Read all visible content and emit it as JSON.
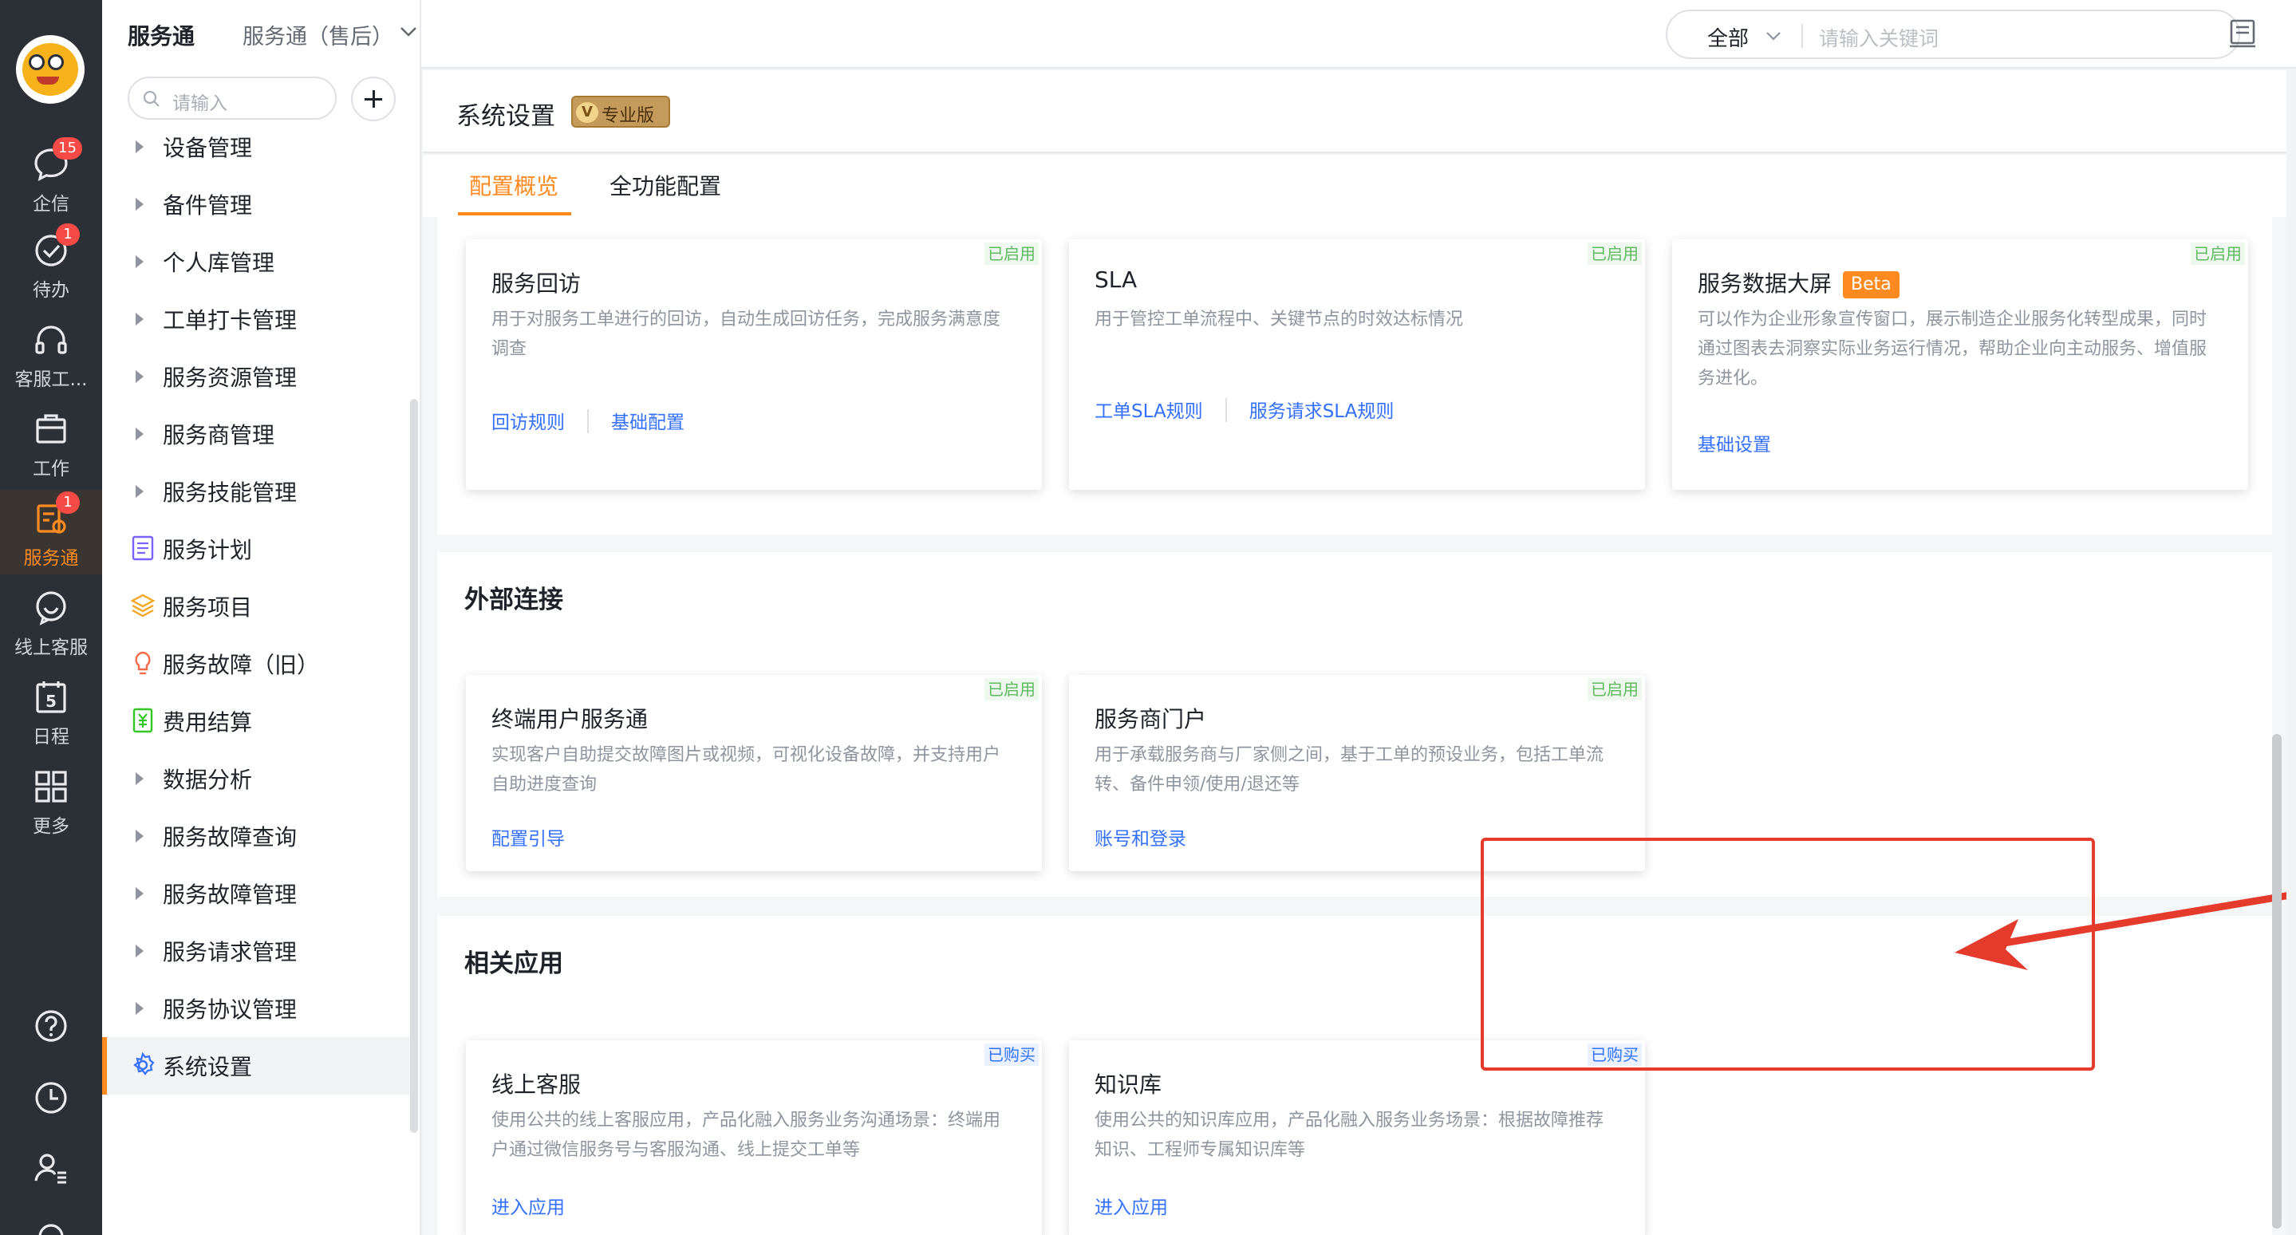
{
  "rail": {
    "items": [
      {
        "label": "企信",
        "icon": "chat-bubble-icon",
        "badge": "15"
      },
      {
        "label": "待办",
        "icon": "check-circle-icon",
        "badge": "1"
      },
      {
        "label": "客服工...",
        "icon": "headset-icon",
        "badge": ""
      },
      {
        "label": "工作",
        "icon": "briefcase-icon",
        "badge": ""
      },
      {
        "label": "服务通",
        "icon": "service-wrench-icon",
        "badge": "1"
      },
      {
        "label": "线上客服",
        "icon": "smile-chat-icon",
        "badge": ""
      },
      {
        "label": "日程",
        "icon": "calendar-icon",
        "badge": "",
        "day": "5"
      },
      {
        "label": "更多",
        "icon": "grid-apps-icon",
        "badge": ""
      }
    ],
    "active_index": 4,
    "accent": "#ff8a1f"
  },
  "sidemenu": {
    "brand": "服务通",
    "subbrand": "服务通（售后）",
    "search_placeholder": "请输入",
    "items": [
      {
        "label": "设备管理",
        "type": "arrow"
      },
      {
        "label": "备件管理",
        "type": "arrow"
      },
      {
        "label": "个人库管理",
        "type": "arrow"
      },
      {
        "label": "工单打卡管理",
        "type": "arrow"
      },
      {
        "label": "服务资源管理",
        "type": "arrow"
      },
      {
        "label": "服务商管理",
        "type": "arrow"
      },
      {
        "label": "服务技能管理",
        "type": "arrow"
      },
      {
        "label": "服务计划",
        "type": "icon",
        "icon": "plan-list-icon"
      },
      {
        "label": "服务项目",
        "type": "icon",
        "icon": "layers-icon"
      },
      {
        "label": "服务故障（旧）",
        "type": "icon",
        "icon": "bulb-icon"
      },
      {
        "label": "费用结算",
        "type": "icon",
        "icon": "yen-receipt-icon"
      },
      {
        "label": "数据分析",
        "type": "arrow"
      },
      {
        "label": "服务故障查询",
        "type": "arrow"
      },
      {
        "label": "服务故障管理",
        "type": "arrow"
      },
      {
        "label": "服务请求管理",
        "type": "arrow"
      },
      {
        "label": "服务协议管理",
        "type": "arrow"
      },
      {
        "label": "系统设置",
        "type": "icon",
        "icon": "gear-icon",
        "selected": true
      }
    ]
  },
  "topbar": {
    "scope": "全部",
    "search_placeholder": "请输入关键词"
  },
  "page": {
    "title": "系统设置",
    "edition_mark": "V",
    "edition": "专业版",
    "tabs": [
      {
        "label": "配置概览",
        "active": true
      },
      {
        "label": "全功能配置",
        "active": false
      }
    ]
  },
  "sections": [
    {
      "title": "",
      "cards": [
        {
          "title": "服务回访",
          "status": "已启用",
          "desc": "用于对服务工单进行的回访，自动生成回访任务，完成服务满意度调查",
          "links": [
            "回访规则",
            "基础配置"
          ]
        },
        {
          "title": "SLA",
          "status": "已启用",
          "desc": "用于管控工单流程中、关键节点的时效达标情况",
          "links": [
            "工单SLA规则",
            "服务请求SLA规则"
          ]
        },
        {
          "title": "服务数据大屏",
          "beta": "Beta",
          "status": "已启用",
          "desc": "可以作为企业形象宣传窗口，展示制造企业服务化转型成果，同时通过图表去洞察实际业务运行情况，帮助企业向主动服务、增值服务进化。",
          "links": [
            "基础设置"
          ]
        }
      ]
    },
    {
      "title": "外部连接",
      "cards": [
        {
          "title": "终端用户服务通",
          "status": "已启用",
          "desc": "实现客户自助提交故障图片或视频，可视化设备故障，并支持用户自助进度查询",
          "links": [
            "配置引导"
          ]
        },
        {
          "title": "服务商门户",
          "status": "已启用",
          "desc": "用于承载服务商与厂家侧之间，基于工单的预设业务，包括工单流转、备件申领/使用/退还等",
          "links": [
            "账号和登录"
          ]
        }
      ]
    },
    {
      "title": "相关应用",
      "cards": [
        {
          "title": "线上客服",
          "status": "已购买",
          "desc": "使用公共的线上客服应用，产品化融入服务业务沟通场景：终端用户通过微信服务号与客服沟通、线上提交工单等",
          "links": [
            "进入应用"
          ]
        },
        {
          "title": "知识库",
          "status": "已购买",
          "desc": "使用公共的知识库应用，产品化融入服务业务场景：根据故障推荐知识、工程师专属知识库等",
          "links": [
            "进入应用"
          ]
        }
      ]
    }
  ],
  "colors": {
    "enabled_tag": "#5fb960",
    "purchased_tag": "#3370ff",
    "link": "#3370ff",
    "annotation": "#e53b2c"
  }
}
